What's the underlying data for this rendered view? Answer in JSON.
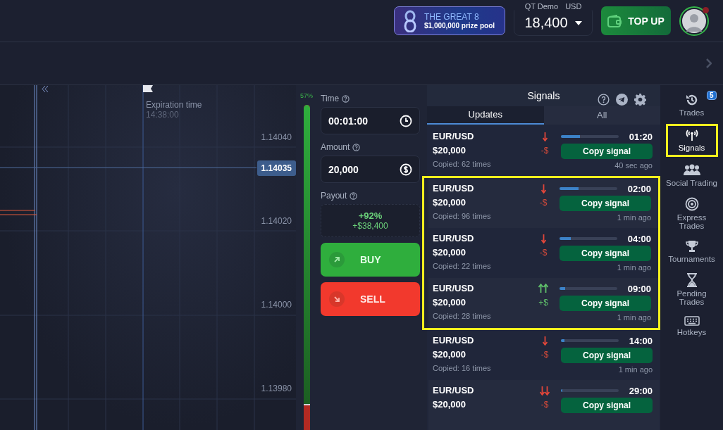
{
  "header": {
    "promo": {
      "title": "THE GREAT 8",
      "subtitle": "$1,000,000 prize pool"
    },
    "account": {
      "label": "QT Demo",
      "currency": "USD",
      "balance": "18,400"
    },
    "top_up": "TOP UP",
    "avatar": {
      "notification": true
    }
  },
  "chart": {
    "expiration": {
      "label": "Expiration time",
      "time": "14:38:00"
    },
    "price_labels": [
      "1.14040",
      "1.14020",
      "1.14000",
      "1.13980"
    ],
    "current_price": "1.14035"
  },
  "sentiment": {
    "reading": "57%",
    "level": 0.92
  },
  "trade_form": {
    "time": {
      "label": "Time",
      "value": "00:01:00"
    },
    "amount": {
      "label": "Amount",
      "value": "20,000"
    },
    "payout": {
      "label": "Payout",
      "percent": "+92%",
      "profit": "+$38,400"
    },
    "buttons": [
      {
        "kind": "buy",
        "label": "BUY"
      },
      {
        "kind": "sell",
        "label": "SELL"
      }
    ]
  },
  "signals": {
    "title": "Signals",
    "tabs": [
      {
        "label": "Updates",
        "selected": true
      },
      {
        "label": "All",
        "selected": false
      }
    ],
    "groups": [
      {
        "highlighted": false,
        "items": [
          {
            "pair": "EUR/USD",
            "amount": "$20,000",
            "copied": "Copied: 62 times",
            "kind": "down",
            "delta": "-$",
            "level": 0.33,
            "time": "01:20",
            "button": "Copy signal",
            "ago": "40 sec ago"
          }
        ]
      },
      {
        "highlighted": true,
        "items": [
          {
            "pair": "EUR/USD",
            "amount": "$20,000",
            "copied": "Copied: 96 times",
            "kind": "down",
            "delta": "-$",
            "level": 0.33,
            "time": "02:00",
            "button": "Copy signal",
            "ago": "1 min ago"
          },
          {
            "pair": "EUR/USD",
            "amount": "$20,000",
            "copied": "Copied: 22 times",
            "kind": "down",
            "delta": "-$",
            "level": 0.2,
            "time": "04:00",
            "button": "Copy signal",
            "ago": "1 min ago"
          },
          {
            "pair": "EUR/USD",
            "amount": "$20,000",
            "copied": "Copied: 28 times",
            "kind": "double-up",
            "delta": "+$",
            "level": 0.1,
            "time": "09:00",
            "button": "Copy signal",
            "ago": "1 min ago"
          }
        ]
      },
      {
        "highlighted": false,
        "items": [
          {
            "pair": "EUR/USD",
            "amount": "$20,000",
            "copied": "Copied: 16 times",
            "kind": "down",
            "delta": "-$",
            "level": 0.06,
            "time": "14:00",
            "button": "Copy signal",
            "ago": "1 min ago"
          },
          {
            "pair": "EUR/USD",
            "amount": "$20,000",
            "kind": "double-down",
            "delta": "-$",
            "level": 0.03,
            "time": "29:00",
            "button": "Copy signal"
          }
        ]
      }
    ]
  },
  "sidebar": {
    "items": [
      {
        "kind": "history",
        "label": "Trades",
        "badge": "5",
        "selected": false,
        "highlighted": false
      },
      {
        "kind": "antenna",
        "label": "Signals",
        "selected": true,
        "highlighted": true
      },
      {
        "kind": "people",
        "label": "Social Trading",
        "selected": false,
        "highlighted": false
      },
      {
        "kind": "target",
        "label": "Express Trades",
        "selected": false,
        "highlighted": false
      },
      {
        "kind": "trophy",
        "label": "Tournaments",
        "selected": false,
        "highlighted": false
      },
      {
        "kind": "hourglass",
        "label": "Pending Trades",
        "selected": false,
        "highlighted": false
      },
      {
        "kind": "keyboard",
        "label": "Hotkeys",
        "selected": false,
        "highlighted": false
      }
    ]
  }
}
